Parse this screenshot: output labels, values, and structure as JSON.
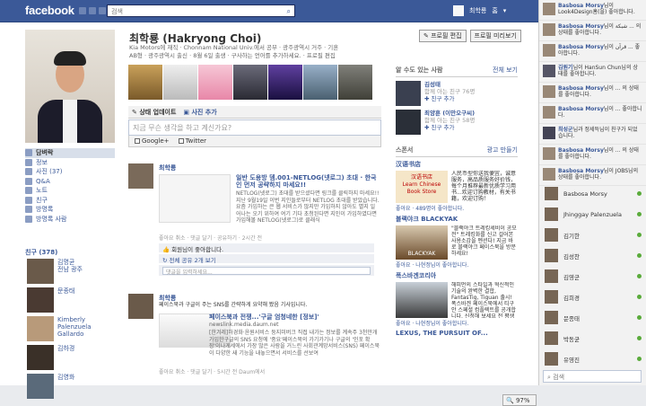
{
  "topbar": {
    "logo": "facebook",
    "search_text": "검색",
    "user_name": "최학룡",
    "home": "홈"
  },
  "profile": {
    "name": "최학룡 (Hakryong Choi)",
    "edit_profile": "✎ 프로필 편집",
    "preview_profile": "프로필 미리보기",
    "info_lines": [
      "Kia Motors에 재직 · Chonnam National Univ.에서 공부 · 광주광역시 거주 · 기혼",
      "AB형 · 광주광역시 출신 · 8월 6일 출생 · 구사하는 언어를 추가하세요. · 프로필 편집"
    ]
  },
  "nav": {
    "items": [
      {
        "label": "담벼락",
        "active": true
      },
      {
        "label": "정보"
      },
      {
        "label": "사진 (37)"
      },
      {
        "label": "Q&A"
      },
      {
        "label": "노트"
      },
      {
        "label": "친구"
      },
      {
        "label": "방명록"
      },
      {
        "label": "방명록 사람"
      }
    ],
    "friends_header": "친구 (378)"
  },
  "friends": [
    {
      "name": "김명균\n전남 광주"
    },
    {
      "name": "문종태"
    },
    {
      "name": "Kimberly\nPalenzuela\nGallardo"
    },
    {
      "name": "김하경"
    },
    {
      "name": "김영화"
    }
  ],
  "tabs": {
    "status": "상태 업데이트",
    "photo": "사진 추가"
  },
  "composer": {
    "placeholder": "지금 무슨 생각을 하고 계신가요?",
    "google": "Google+",
    "twitter": "Twitter"
  },
  "stories": [
    {
      "author": "최학룡",
      "title": "일반 도용방 뎀.001-NETLOG(넷로그) 초대 · 한국인 먼저 공략하지 마세요!!",
      "desc": "NETLOG(넷로그) 초대를 받으셨다면 링크를 클릭하지 마세요!! 지난 9월19일 이번 지인들로부터 NETLOG 초대를 받았습니다. 요즘 가입하는 큰 웹 서비스가 많지만 가입하지 않아도 별지 일어나는 오기 위하여 여기 기다 초청된다면 지인이 가입하였다면 가입해볼 NETLOG(넷로그)로 클래식",
      "meta": "좋아요 취소 · 댓글 달기 · 공유하기 · 2시간 전",
      "likes": "회원님이 좋아합니다.",
      "share": "전체 공유 2개 보기",
      "comment_placeholder": "댓글을 입력하세요..."
    },
    {
      "author": "최학룡",
      "summary": "페이스북과 구글이 주는 SNS를 간략하게 요약해 봤음 기사입니다.",
      "title": "페이스북과 전쟁...'구글 엄청네한 [정보]'",
      "source": "newslink.media.daum.net",
      "desc": "[한겨레]하경화·윤원서비스 둥지미버크 직접 내가는 정보를 계속주 3천만개 가입한구글의 SNS 요청에 '중요'페이스북의 가기가기나 구글의 '인포 확장'이나게세에서 가장 많은 사람을 거느린 사회관계망서비스(SNS) 페이스북이 다양한 새 기능을 내놓으면서 서비스를 선보여",
      "meta": "좋아요 취소 · 댓글 달기 · 5시간 전 Daum에서"
    }
  ],
  "right": {
    "pymk_header": "알 수도 있는 사람",
    "see_all": "전체 보기",
    "people": [
      {
        "name": "김성태",
        "mutual": "함께 아는 친구 76명",
        "action": "친구 추가"
      },
      {
        "name": "최양훈 (이만오구씨)",
        "mutual": "함께 아는 친구 58명",
        "action": "친구 추가"
      }
    ],
    "sponsor_header": "스폰서",
    "create_ad": "광고 만들기",
    "ads": [
      {
        "title": "汉语书店",
        "img_text": "汉语书店\nLearn Chinese\nBook Store",
        "text": "人民币型你送我便宜，诚意服务，高品质服务好价钱，每个月推荐最新优质学习用书...欢迎订购教材，有关书籍，欢迎订购！",
        "like": "좋아요 · 489명이 좋아합니다."
      },
      {
        "title": "블랙야크 BLACKYAK",
        "img_text": "BLACKYAK",
        "text": "\"블랙야크 트레킹세비이 공모전\" 트레킹화를 신고 걸어본 사용소감을 멘션다! 지금 바로 블랙야크 페이스북을 방문하세요!",
        "like": "좋아요 · 나현정님이 좋아합니다."
      },
      {
        "title": "폭스바겐코리아",
        "img_text": "",
        "text": "해피먼의 스타일과 혁신적인 기술의 완벽한 결합, FantasTig, Tiguan 출시! 폭스바겐 페이스북에서 티구안 스페셜 컴플렉트를 공개합니다. 신청해 보세요 전 평생 최고 드라이빙! 예 수 있는 기회를 드립니다.",
        "like": "좋아요 · 나현정님이 좋아합니다."
      },
      {
        "title": "LEXUS, THE PURSUIT OF...",
        "img_text": "",
        "text": "",
        "like": ""
      }
    ]
  },
  "ticker": [
    {
      "name": "Basbosa Morsy",
      "text": "님이 Look4Design홈(을) 좋아합니다."
    },
    {
      "name": "Basbosa Morsy",
      "text": "님이 شبكة ... 의 상태를 좋아합니다."
    },
    {
      "name": "Basbosa Morsy",
      "text": "님이 قرآن ... 좋아합니다."
    },
    {
      "name": "김원기",
      "text": "님이 HanSun Chun님의 상태를 좋아합니다."
    },
    {
      "name": "Basbosa Morsy",
      "text": "님이 ... 의 상태를 좋아합니다."
    },
    {
      "name": "Basbosa Morsy",
      "text": "님이 ... 좋아합니다."
    },
    {
      "name": "최성군",
      "text": "님과 정세득님이 친구가 되었습니다."
    },
    {
      "name": "Basbosa Morsy",
      "text": "님이 ... 의 상태를 좋아합니다."
    },
    {
      "name": "Basbosa Morsy",
      "text": "님이 JOBS님의 상태를 좋아합니다."
    }
  ],
  "chat": {
    "people": [
      {
        "name": "Basbosa Morsy"
      },
      {
        "name": "Jhinggay Palenzuela"
      },
      {
        "name": "김기한"
      },
      {
        "name": "김성찬"
      },
      {
        "name": "김영군"
      },
      {
        "name": "김희경"
      },
      {
        "name": "문종태"
      },
      {
        "name": "박동균"
      },
      {
        "name": "유영진"
      },
      {
        "name": "이정기"
      },
      {
        "name": "이현영"
      }
    ],
    "search": "검색"
  },
  "zoom": "97%"
}
